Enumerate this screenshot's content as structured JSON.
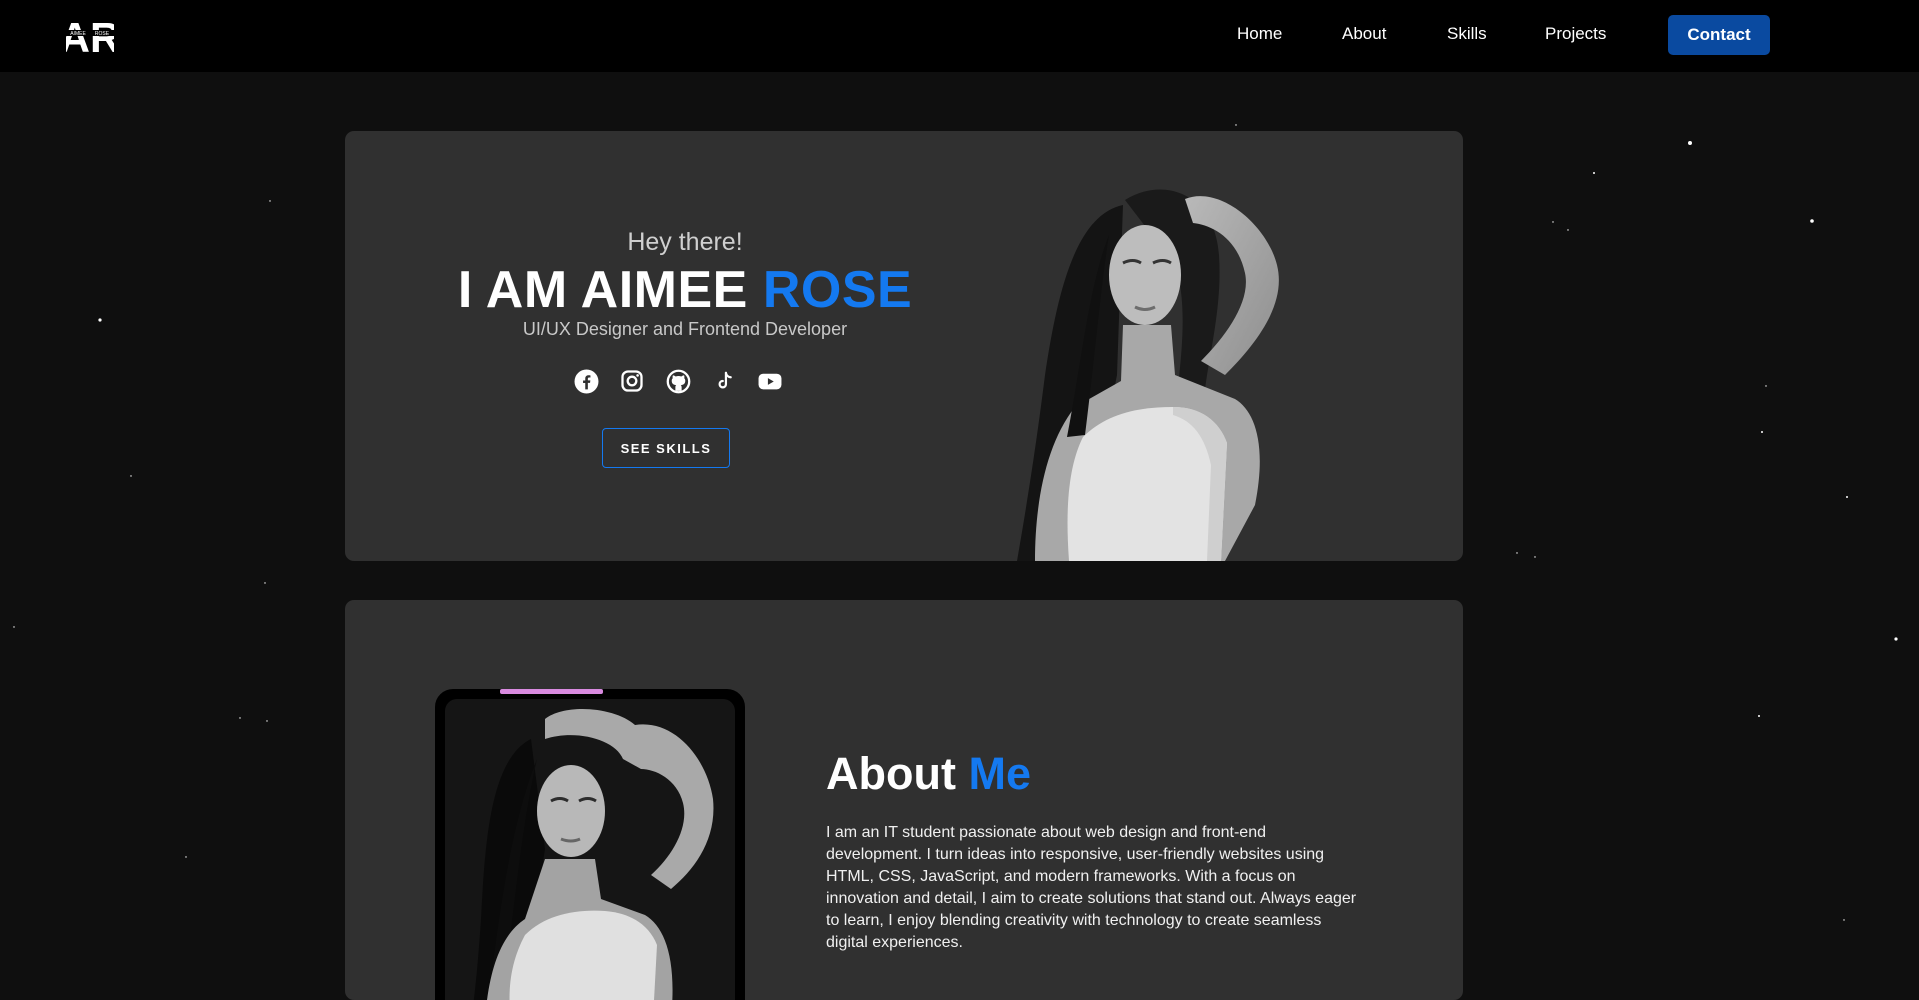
{
  "nav": {
    "logo": {
      "letters": "AR",
      "small_left": "AIMEE",
      "small_right": "ROSE"
    },
    "links": [
      {
        "label": "Home"
      },
      {
        "label": "About"
      },
      {
        "label": "Skills"
      },
      {
        "label": "Projects"
      }
    ],
    "contact_label": "Contact"
  },
  "hero": {
    "greeting": "Hey there!",
    "name_main": "I AM AIMEE",
    "name_accent": "ROSE",
    "role": "UI/UX Designer and Frontend Developer",
    "socials": [
      "facebook-icon",
      "instagram-icon",
      "github-icon",
      "tiktok-icon",
      "youtube-icon"
    ],
    "cta_label": "SEE SKILLS"
  },
  "about": {
    "title_main": "About",
    "title_accent": "Me",
    "body": "I am an IT student passionate about web design and front-end development. I turn ideas into responsive, user-friendly websites using HTML, CSS, JavaScript, and modern frameworks. With a focus on innovation and detail, I aim to create solutions that stand out. Always eager to learn, I enjoy blending creativity with technology to create seamless digital experiences."
  },
  "colors": {
    "accent": "#1479f0",
    "contact_button": "#0a4aa0",
    "card_bg": "#303030",
    "page_bg": "#0f0f0f",
    "phone_notch": "#d98be0"
  }
}
